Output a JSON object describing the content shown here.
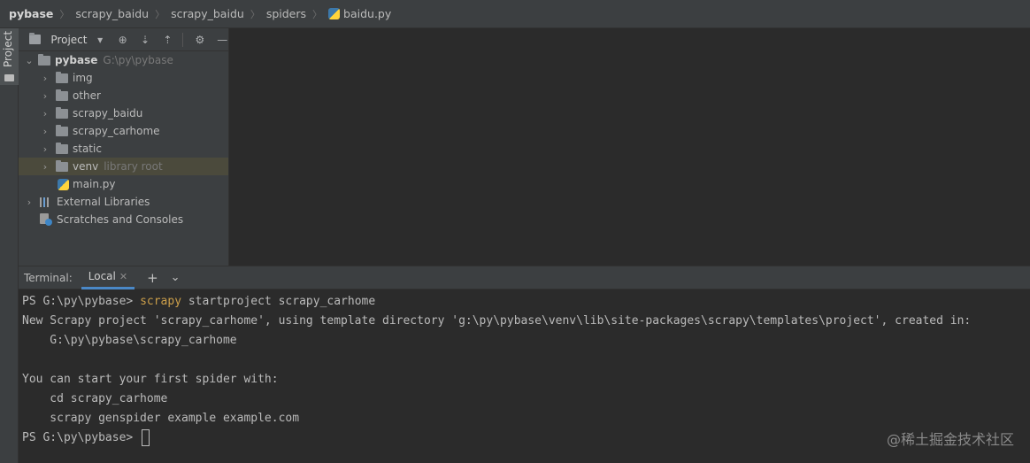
{
  "breadcrumb": {
    "items": [
      "pybase",
      "scrapy_baidu",
      "scrapy_baidu",
      "spiders",
      "baidu.py"
    ]
  },
  "tool_strip": {
    "project_label": "Project"
  },
  "project_panel": {
    "title": "Project",
    "tree": [
      {
        "label": "pybase",
        "hint": "G:\\py\\pybase",
        "expanded": true
      },
      {
        "label": "img"
      },
      {
        "label": "other"
      },
      {
        "label": "scrapy_baidu"
      },
      {
        "label": "scrapy_carhome"
      },
      {
        "label": "static"
      },
      {
        "label": "venv",
        "hint": "library root"
      },
      {
        "label": "main.py"
      },
      {
        "label": "External Libraries"
      },
      {
        "label": "Scratches and Consoles"
      }
    ]
  },
  "terminal": {
    "title": "Terminal:",
    "tab_label": "Local",
    "prompt": "PS G:\\py\\pybase> ",
    "command_name": "scrapy",
    "command_args": " startproject scrapy_carhome",
    "output": [
      "New Scrapy project 'scrapy_carhome', using template directory 'g:\\py\\pybase\\venv\\lib\\site-packages\\scrapy\\templates\\project', created in:",
      "    G:\\py\\pybase\\scrapy_carhome",
      "",
      "You can start your first spider with:",
      "    cd scrapy_carhome",
      "    scrapy genspider example example.com"
    ],
    "final_prompt": "PS G:\\py\\pybase> "
  },
  "watermark": "@稀土掘金技术社区",
  "colors": {
    "command": "#cc9f4a",
    "tab_underline": "#4a88c7",
    "selected_row": "#4b4a3c"
  }
}
